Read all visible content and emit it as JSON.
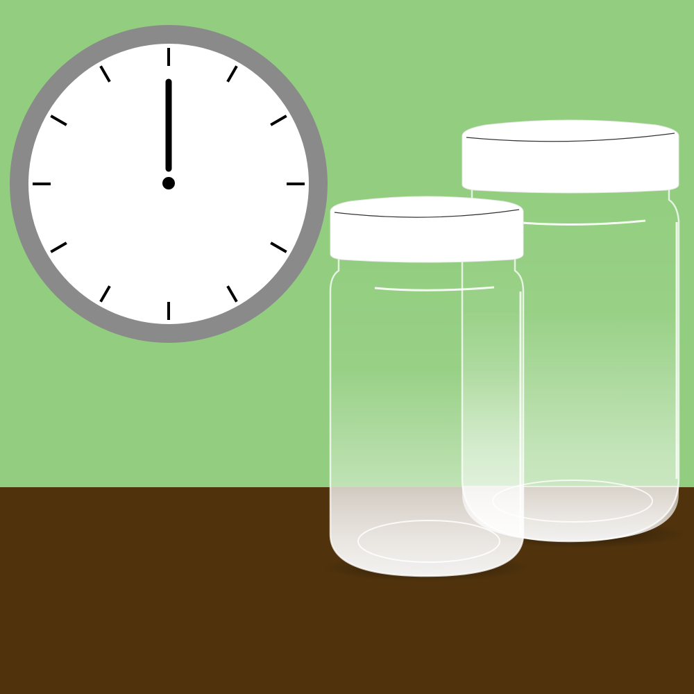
{
  "scene": {
    "description_visible_text": "",
    "colors": {
      "wall": "#93ce80",
      "table": "#50330d",
      "clock_rim": "#8a8a8a",
      "clock_face": "#ffffff",
      "clock_marks": "#000000",
      "jar_glass": "#ffffff",
      "jar_lid": "#ffffff"
    },
    "clock": {
      "time_shown": "12:00",
      "tick_count": 12
    },
    "jars": [
      {
        "label": "front-jar",
        "lid_color": "#ffffff"
      },
      {
        "label": "back-jar",
        "lid_color": "#ffffff"
      }
    ]
  }
}
